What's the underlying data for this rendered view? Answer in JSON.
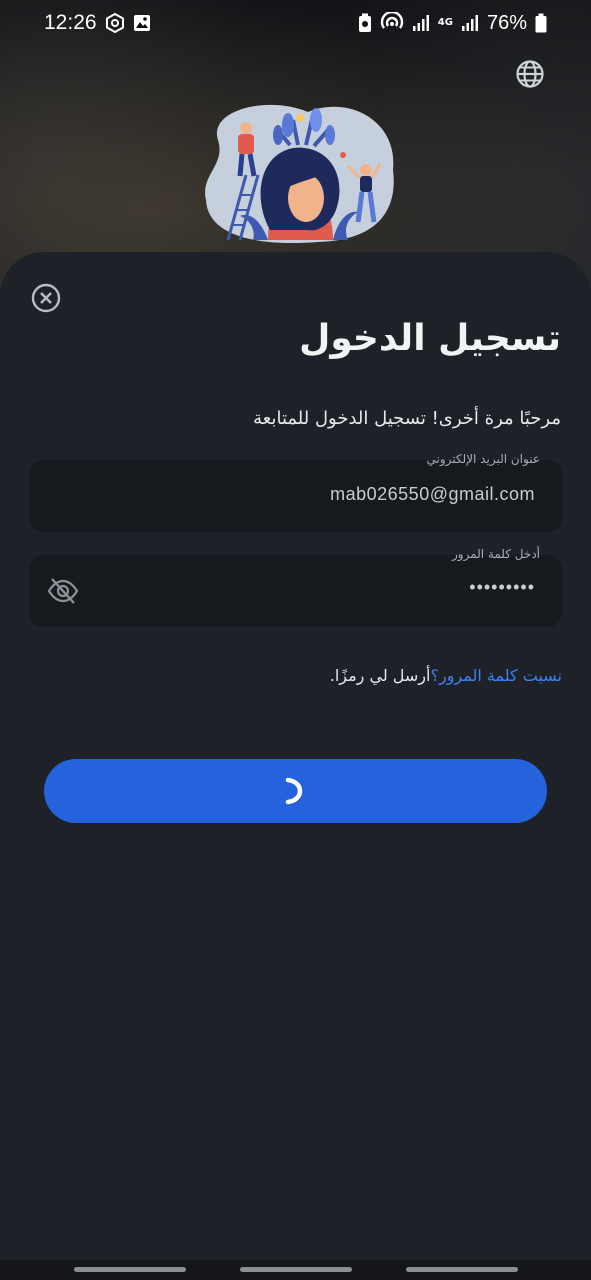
{
  "status_bar": {
    "time": "12:26",
    "battery_percent": "76%",
    "network_label": "4G",
    "icons": [
      "settings-hex-icon",
      "gallery-icon",
      "battery-saver-icon",
      "hotspot-icon",
      "signal-icon",
      "signal-icon",
      "battery-icon"
    ]
  },
  "header": {
    "language_icon": "globe-icon",
    "illustration": "person-with-plants-illustration"
  },
  "login": {
    "title": "تسجيل الدخول",
    "subtitle": "مرحبًا مرة أخرى! تسجيل الدخول للمتابعة",
    "email": {
      "label": "عنوان البريد الإلكتروني",
      "value": "mab026550@gmail.com"
    },
    "password": {
      "label": "أدخل كلمة المرور",
      "value": "•••••••••",
      "toggle_icon": "eye-off-icon"
    },
    "forgot_link": "نسيت كلمة المرور؟",
    "send_code": "أرسل لي رمزًا.",
    "submit_state": "loading"
  },
  "colors": {
    "accent": "#2563dc",
    "link": "#3b82f6",
    "sheet_bg": "#1e2228",
    "field_bg": "#16191d"
  }
}
